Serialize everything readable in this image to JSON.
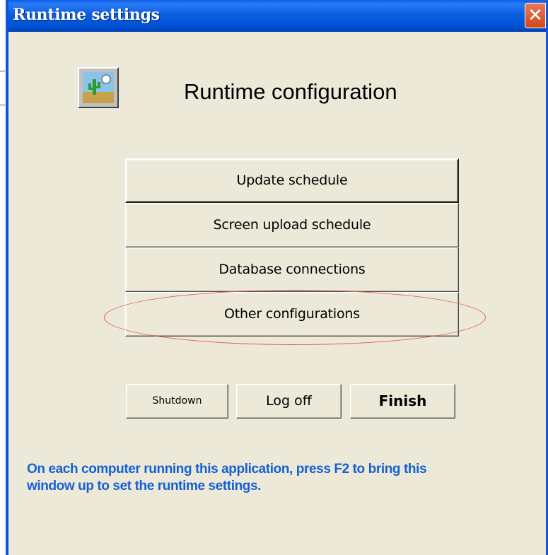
{
  "window": {
    "title": "Runtime settings",
    "close_glyph": "✕",
    "app_icon": "cactus-landscape-icon"
  },
  "main": {
    "heading": "Runtime configuration",
    "options": [
      {
        "label": "Update schedule"
      },
      {
        "label": "Screen upload schedule"
      },
      {
        "label": "Database connections"
      },
      {
        "label": "Other configurations"
      }
    ]
  },
  "actions": {
    "shutdown_label": "Shutdown",
    "logoff_label": "Log off",
    "finish_label": "Finish"
  },
  "hint": {
    "line1": "On each computer running this application, press F2 to bring this",
    "line2": "window up to set the runtime settings."
  },
  "colors": {
    "titlebar": "#0a5fe0",
    "close_button": "#d1481c",
    "window_face": "#ece9d8",
    "hint_text": "#1560d6",
    "highlight_ellipse": "#e05a5a"
  }
}
